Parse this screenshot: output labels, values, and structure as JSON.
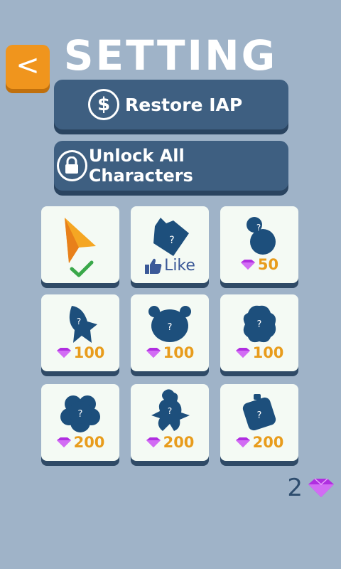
{
  "screen": {
    "title": "SETTING",
    "back_label": "<"
  },
  "buttons": {
    "restore_label": "Restore IAP",
    "unlock_label": "Unlock All Characters"
  },
  "characters": [
    {
      "id": "arrow",
      "state": "selected"
    },
    {
      "id": "locked-like",
      "state": "like",
      "like_label": "Like"
    },
    {
      "id": "gourd",
      "price": "50"
    },
    {
      "id": "rocket",
      "price": "100"
    },
    {
      "id": "bear",
      "price": "100"
    },
    {
      "id": "blob",
      "price": "100"
    },
    {
      "id": "cloud",
      "price": "200"
    },
    {
      "id": "rooster",
      "price": "200"
    },
    {
      "id": "cube",
      "price": "200"
    }
  ],
  "wallet": {
    "gem_count": "2"
  },
  "colors": {
    "background": "#9fb3c8",
    "button_blue": "#3e5f81",
    "back_orange": "#f0951d",
    "price_orange": "#e89c1c",
    "gem_purple": "#b02ee0",
    "silhouette": "#1d4f7c"
  }
}
